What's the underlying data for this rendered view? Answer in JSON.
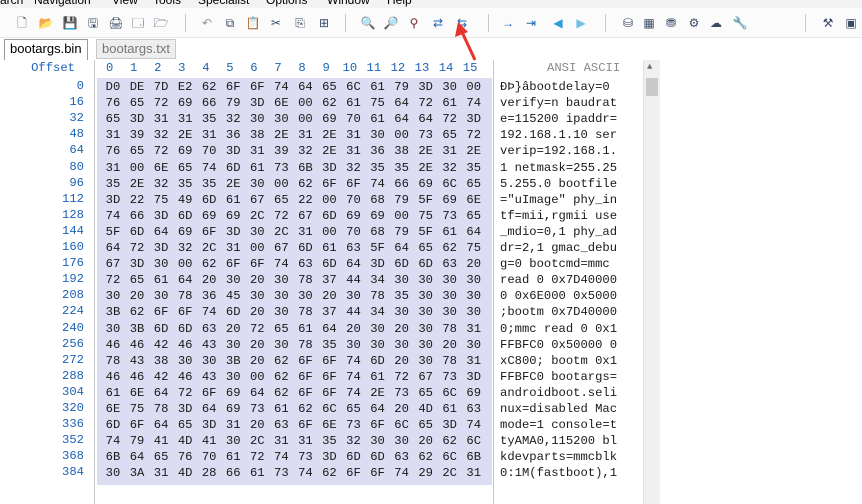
{
  "menu": {
    "items": [
      "arch",
      "Navigation",
      "View",
      "Tools",
      "Specialist",
      "Options",
      "Window",
      "Help"
    ]
  },
  "toolbar": {
    "icons": [
      "new-file-icon",
      "open-file-icon",
      "save-icon",
      "save-all-icon",
      "print-icon",
      "properties-icon",
      "open-drive-icon",
      "undo-icon",
      "copy-icon",
      "paste-icon",
      "cut-icon",
      "paste-special-icon",
      "hex-toggle-icon",
      "find-icon",
      "find-next-icon",
      "find-hex-icon",
      "replace-icon",
      "replace-hex-icon",
      "goto-icon",
      "goto-block-icon",
      "back-icon",
      "forward-icon",
      "disk-icon",
      "ram-icon",
      "drive-icon",
      "process-icon",
      "network-icon",
      "tool-icon",
      "options-icon",
      "window-icon"
    ]
  },
  "tabs": [
    {
      "label": "bootargs.bin",
      "active": true
    },
    {
      "label": "bootargs.txt",
      "active": false
    }
  ],
  "header": {
    "offset_label": "Offset",
    "columns": [
      "0",
      "1",
      "2",
      "3",
      "4",
      "5",
      "6",
      "7",
      "8",
      "9",
      "10",
      "11",
      "12",
      "13",
      "14",
      "15"
    ],
    "ascii_label": "ANSI ASCII"
  },
  "rows": [
    {
      "offset": "0",
      "hex": [
        "D0",
        "DE",
        "7D",
        "E2",
        "62",
        "6F",
        "6F",
        "74",
        "64",
        "65",
        "6C",
        "61",
        "79",
        "3D",
        "30",
        "00"
      ],
      "ascii": "ÐÞ}âbootdelay=0"
    },
    {
      "offset": "16",
      "hex": [
        "76",
        "65",
        "72",
        "69",
        "66",
        "79",
        "3D",
        "6E",
        "00",
        "62",
        "61",
        "75",
        "64",
        "72",
        "61",
        "74"
      ],
      "ascii": "verify=n baudrat"
    },
    {
      "offset": "32",
      "hex": [
        "65",
        "3D",
        "31",
        "31",
        "35",
        "32",
        "30",
        "30",
        "00",
        "69",
        "70",
        "61",
        "64",
        "64",
        "72",
        "3D"
      ],
      "ascii": "e=115200 ipaddr="
    },
    {
      "offset": "48",
      "hex": [
        "31",
        "39",
        "32",
        "2E",
        "31",
        "36",
        "38",
        "2E",
        "31",
        "2E",
        "31",
        "30",
        "00",
        "73",
        "65",
        "72"
      ],
      "ascii": "192.168.1.10 ser"
    },
    {
      "offset": "64",
      "hex": [
        "76",
        "65",
        "72",
        "69",
        "70",
        "3D",
        "31",
        "39",
        "32",
        "2E",
        "31",
        "36",
        "38",
        "2E",
        "31",
        "2E"
      ],
      "ascii": "verip=192.168.1."
    },
    {
      "offset": "80",
      "hex": [
        "31",
        "00",
        "6E",
        "65",
        "74",
        "6D",
        "61",
        "73",
        "6B",
        "3D",
        "32",
        "35",
        "35",
        "2E",
        "32",
        "35"
      ],
      "ascii": "1 netmask=255.25"
    },
    {
      "offset": "96",
      "hex": [
        "35",
        "2E",
        "32",
        "35",
        "35",
        "2E",
        "30",
        "00",
        "62",
        "6F",
        "6F",
        "74",
        "66",
        "69",
        "6C",
        "65"
      ],
      "ascii": "5.255.0 bootfile"
    },
    {
      "offset": "112",
      "hex": [
        "3D",
        "22",
        "75",
        "49",
        "6D",
        "61",
        "67",
        "65",
        "22",
        "00",
        "70",
        "68",
        "79",
        "5F",
        "69",
        "6E"
      ],
      "ascii": "=\"uImage\" phy_in"
    },
    {
      "offset": "128",
      "hex": [
        "74",
        "66",
        "3D",
        "6D",
        "69",
        "69",
        "2C",
        "72",
        "67",
        "6D",
        "69",
        "69",
        "00",
        "75",
        "73",
        "65"
      ],
      "ascii": "tf=mii,rgmii use"
    },
    {
      "offset": "144",
      "hex": [
        "5F",
        "6D",
        "64",
        "69",
        "6F",
        "3D",
        "30",
        "2C",
        "31",
        "00",
        "70",
        "68",
        "79",
        "5F",
        "61",
        "64"
      ],
      "ascii": "_mdio=0,1 phy_ad"
    },
    {
      "offset": "160",
      "hex": [
        "64",
        "72",
        "3D",
        "32",
        "2C",
        "31",
        "00",
        "67",
        "6D",
        "61",
        "63",
        "5F",
        "64",
        "65",
        "62",
        "75"
      ],
      "ascii": "dr=2,1 gmac_debu"
    },
    {
      "offset": "176",
      "hex": [
        "67",
        "3D",
        "30",
        "00",
        "62",
        "6F",
        "6F",
        "74",
        "63",
        "6D",
        "64",
        "3D",
        "6D",
        "6D",
        "63",
        "20"
      ],
      "ascii": "g=0 bootcmd=mmc "
    },
    {
      "offset": "192",
      "hex": [
        "72",
        "65",
        "61",
        "64",
        "20",
        "30",
        "20",
        "30",
        "78",
        "37",
        "44",
        "34",
        "30",
        "30",
        "30",
        "30"
      ],
      "ascii": "read 0 0x7D40000"
    },
    {
      "offset": "208",
      "hex": [
        "30",
        "20",
        "30",
        "78",
        "36",
        "45",
        "30",
        "30",
        "30",
        "20",
        "30",
        "78",
        "35",
        "30",
        "30",
        "30"
      ],
      "ascii": "0 0x6E000 0x5000"
    },
    {
      "offset": "224",
      "hex": [
        "3B",
        "62",
        "6F",
        "6F",
        "74",
        "6D",
        "20",
        "30",
        "78",
        "37",
        "44",
        "34",
        "30",
        "30",
        "30",
        "30"
      ],
      "ascii": ";bootm 0x7D40000"
    },
    {
      "offset": "240",
      "hex": [
        "30",
        "3B",
        "6D",
        "6D",
        "63",
        "20",
        "72",
        "65",
        "61",
        "64",
        "20",
        "30",
        "20",
        "30",
        "78",
        "31"
      ],
      "ascii": "0;mmc read 0 0x1"
    },
    {
      "offset": "256",
      "hex": [
        "46",
        "46",
        "42",
        "46",
        "43",
        "30",
        "20",
        "30",
        "78",
        "35",
        "30",
        "30",
        "30",
        "30",
        "20",
        "30"
      ],
      "ascii": "FFBFC0 0x50000 0"
    },
    {
      "offset": "272",
      "hex": [
        "78",
        "43",
        "38",
        "30",
        "30",
        "3B",
        "20",
        "62",
        "6F",
        "6F",
        "74",
        "6D",
        "20",
        "30",
        "78",
        "31"
      ],
      "ascii": "xC800; bootm 0x1"
    },
    {
      "offset": "288",
      "hex": [
        "46",
        "46",
        "42",
        "46",
        "43",
        "30",
        "00",
        "62",
        "6F",
        "6F",
        "74",
        "61",
        "72",
        "67",
        "73",
        "3D"
      ],
      "ascii": "FFBFC0 bootargs="
    },
    {
      "offset": "304",
      "hex": [
        "61",
        "6E",
        "64",
        "72",
        "6F",
        "69",
        "64",
        "62",
        "6F",
        "6F",
        "74",
        "2E",
        "73",
        "65",
        "6C",
        "69"
      ],
      "ascii": "androidboot.seli"
    },
    {
      "offset": "320",
      "hex": [
        "6E",
        "75",
        "78",
        "3D",
        "64",
        "69",
        "73",
        "61",
        "62",
        "6C",
        "65",
        "64",
        "20",
        "4D",
        "61",
        "63"
      ],
      "ascii": "nux=disabled Mac"
    },
    {
      "offset": "336",
      "hex": [
        "6D",
        "6F",
        "64",
        "65",
        "3D",
        "31",
        "20",
        "63",
        "6F",
        "6E",
        "73",
        "6F",
        "6C",
        "65",
        "3D",
        "74"
      ],
      "ascii": "mode=1 console=t"
    },
    {
      "offset": "352",
      "hex": [
        "74",
        "79",
        "41",
        "4D",
        "41",
        "30",
        "2C",
        "31",
        "31",
        "35",
        "32",
        "30",
        "30",
        "20",
        "62",
        "6C"
      ],
      "ascii": "tyAMA0,115200 bl"
    },
    {
      "offset": "368",
      "hex": [
        "6B",
        "64",
        "65",
        "76",
        "70",
        "61",
        "72",
        "74",
        "73",
        "3D",
        "6D",
        "6D",
        "63",
        "62",
        "6C",
        "6B"
      ],
      "ascii": "kdevparts=mmcblk"
    },
    {
      "offset": "384",
      "hex": [
        "30",
        "3A",
        "31",
        "4D",
        "28",
        "66",
        "61",
        "73",
        "74",
        "62",
        "6F",
        "6F",
        "74",
        "29",
        "2C",
        "31"
      ],
      "ascii": "0:1M(fastboot),1"
    }
  ],
  "colors": {
    "accent": "#1e63b5",
    "hex_bg": "#dcdcf2",
    "arrow": "#e8332a"
  }
}
